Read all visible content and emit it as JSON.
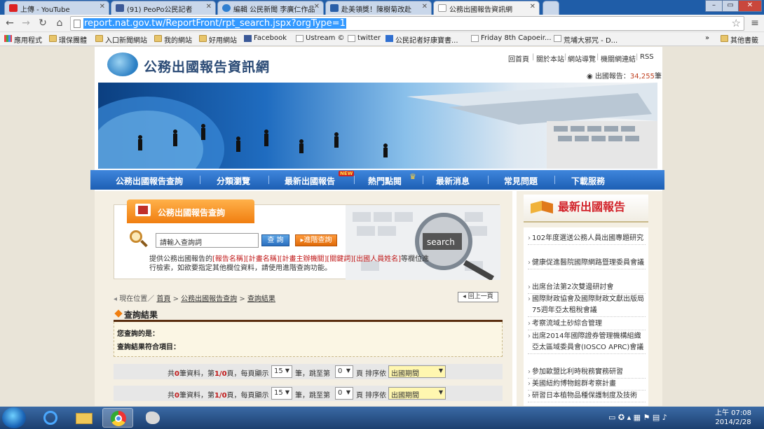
{
  "browser": {
    "tabs": [
      {
        "title": "上傳 - YouTube",
        "icon": "youtube-icon",
        "active": false
      },
      {
        "title": "(91) PeoPo公民記者",
        "icon": "facebook-icon",
        "active": false
      },
      {
        "title": "編輯 公民新聞 李廣仁作品",
        "icon": "peopo-icon",
        "active": false
      },
      {
        "title": "赴美領獎！陳樹菊改赴",
        "icon": "news-icon",
        "active": false
      },
      {
        "title": "公務出國報告資訊網",
        "icon": "page-icon",
        "active": true
      }
    ],
    "url": "report.nat.gov.tw/ReportFront/rpt_search.jspx?orgType=1",
    "bookmarks": [
      {
        "label": "應用程式",
        "icon": "apps-icon"
      },
      {
        "label": "環保團體",
        "icon": "folder-icon"
      },
      {
        "label": "入口新聞網站",
        "icon": "folder-icon"
      },
      {
        "label": "我的網站",
        "icon": "folder-icon"
      },
      {
        "label": "好用網站",
        "icon": "folder-icon"
      },
      {
        "label": "Facebook",
        "icon": "facebook-icon"
      },
      {
        "label": "Ustream ©",
        "icon": "page-icon"
      },
      {
        "label": "twitter",
        "icon": "page-icon"
      },
      {
        "label": "公民記者好康寶書...",
        "icon": "u-icon"
      },
      {
        "label": "Friday 8th Capoeir...",
        "icon": "page-icon"
      },
      {
        "label": "荒埔大邪咒 - D...",
        "icon": "page-icon"
      }
    ],
    "bookmarks_overflow": "»",
    "other_bookmarks": "其他書籤"
  },
  "site": {
    "title": "公務出國報告資訊網",
    "top_links": [
      "回首頁",
      "關於本站",
      "網站導覽",
      "機關網連結",
      "RSS"
    ],
    "report_count_label": "出國報告：",
    "report_count": "34,255",
    "report_count_unit": "筆"
  },
  "nav": [
    "公務出國報告查詢",
    "分類瀏覽",
    "最新出國報告",
    "熱門點閱",
    "最新消息",
    "常見問題",
    "下載服務"
  ],
  "nav_new_badge": "NEW",
  "search": {
    "title": "公務出國報告查詢",
    "placeholder": "請輸入查詢詞",
    "search_button": "查 詢",
    "advanced_button": "進階查詢",
    "art_text": "search",
    "desc_prefix": "提供公務出國報告的",
    "desc_fields": "[報告名稱][計畫名稱][計畫主辦機關][關鍵詞][出國人員姓名]",
    "desc_suffix": "等欄位進行檢索，如欲要指定其他欄位資料，請使用進階查詢功能。"
  },
  "breadcrumb": {
    "prefix": "現在位置／",
    "items": [
      "首頁",
      "公務出國報告查詢",
      "查詢結果"
    ],
    "separator": ">",
    "back_button": "回上一頁"
  },
  "results": {
    "title": "查詢結果",
    "query_label": "您查詢的是：",
    "match_label": "查詢結果符合項目："
  },
  "pager": {
    "total_prefix": "共",
    "total": "0",
    "total_suffix": "筆資料，第",
    "page": "1/0",
    "page_suffix": "頁，每頁顯示",
    "per_page": "15",
    "per_page_suffix": "筆，跳至第",
    "jump": "0",
    "jump_suffix": "頁 排序依",
    "sort": "出國期間"
  },
  "sidebar": {
    "title": "最新出國報告",
    "items": [
      "102年度選送公務人員出國專題研究",
      "健康促進醫院國際網路暨理委員會議",
      "出席台法第2次雙邊研討會",
      "國際財政協會及國際財政文獻出版局75週年亞太租稅會議",
      "考察流域土砂綜合管理",
      "出席2014年國際證券管理機構組織亞太區域委員會(IOSCO APRC)會議",
      "參加歐盟比利時稅務實務研習",
      "美國紐約博物館群考察計畫",
      "研習日本植物品種保護制度及技術"
    ]
  },
  "taskbar": {
    "time": "上午 07:08",
    "date": "2014/2/28"
  },
  "colors": {
    "nav_blue": "#1d5fb4",
    "accent_orange": "#f07e10",
    "sidebar_title_red": "#d2232a",
    "chrome_blue": "#1f5da8"
  }
}
